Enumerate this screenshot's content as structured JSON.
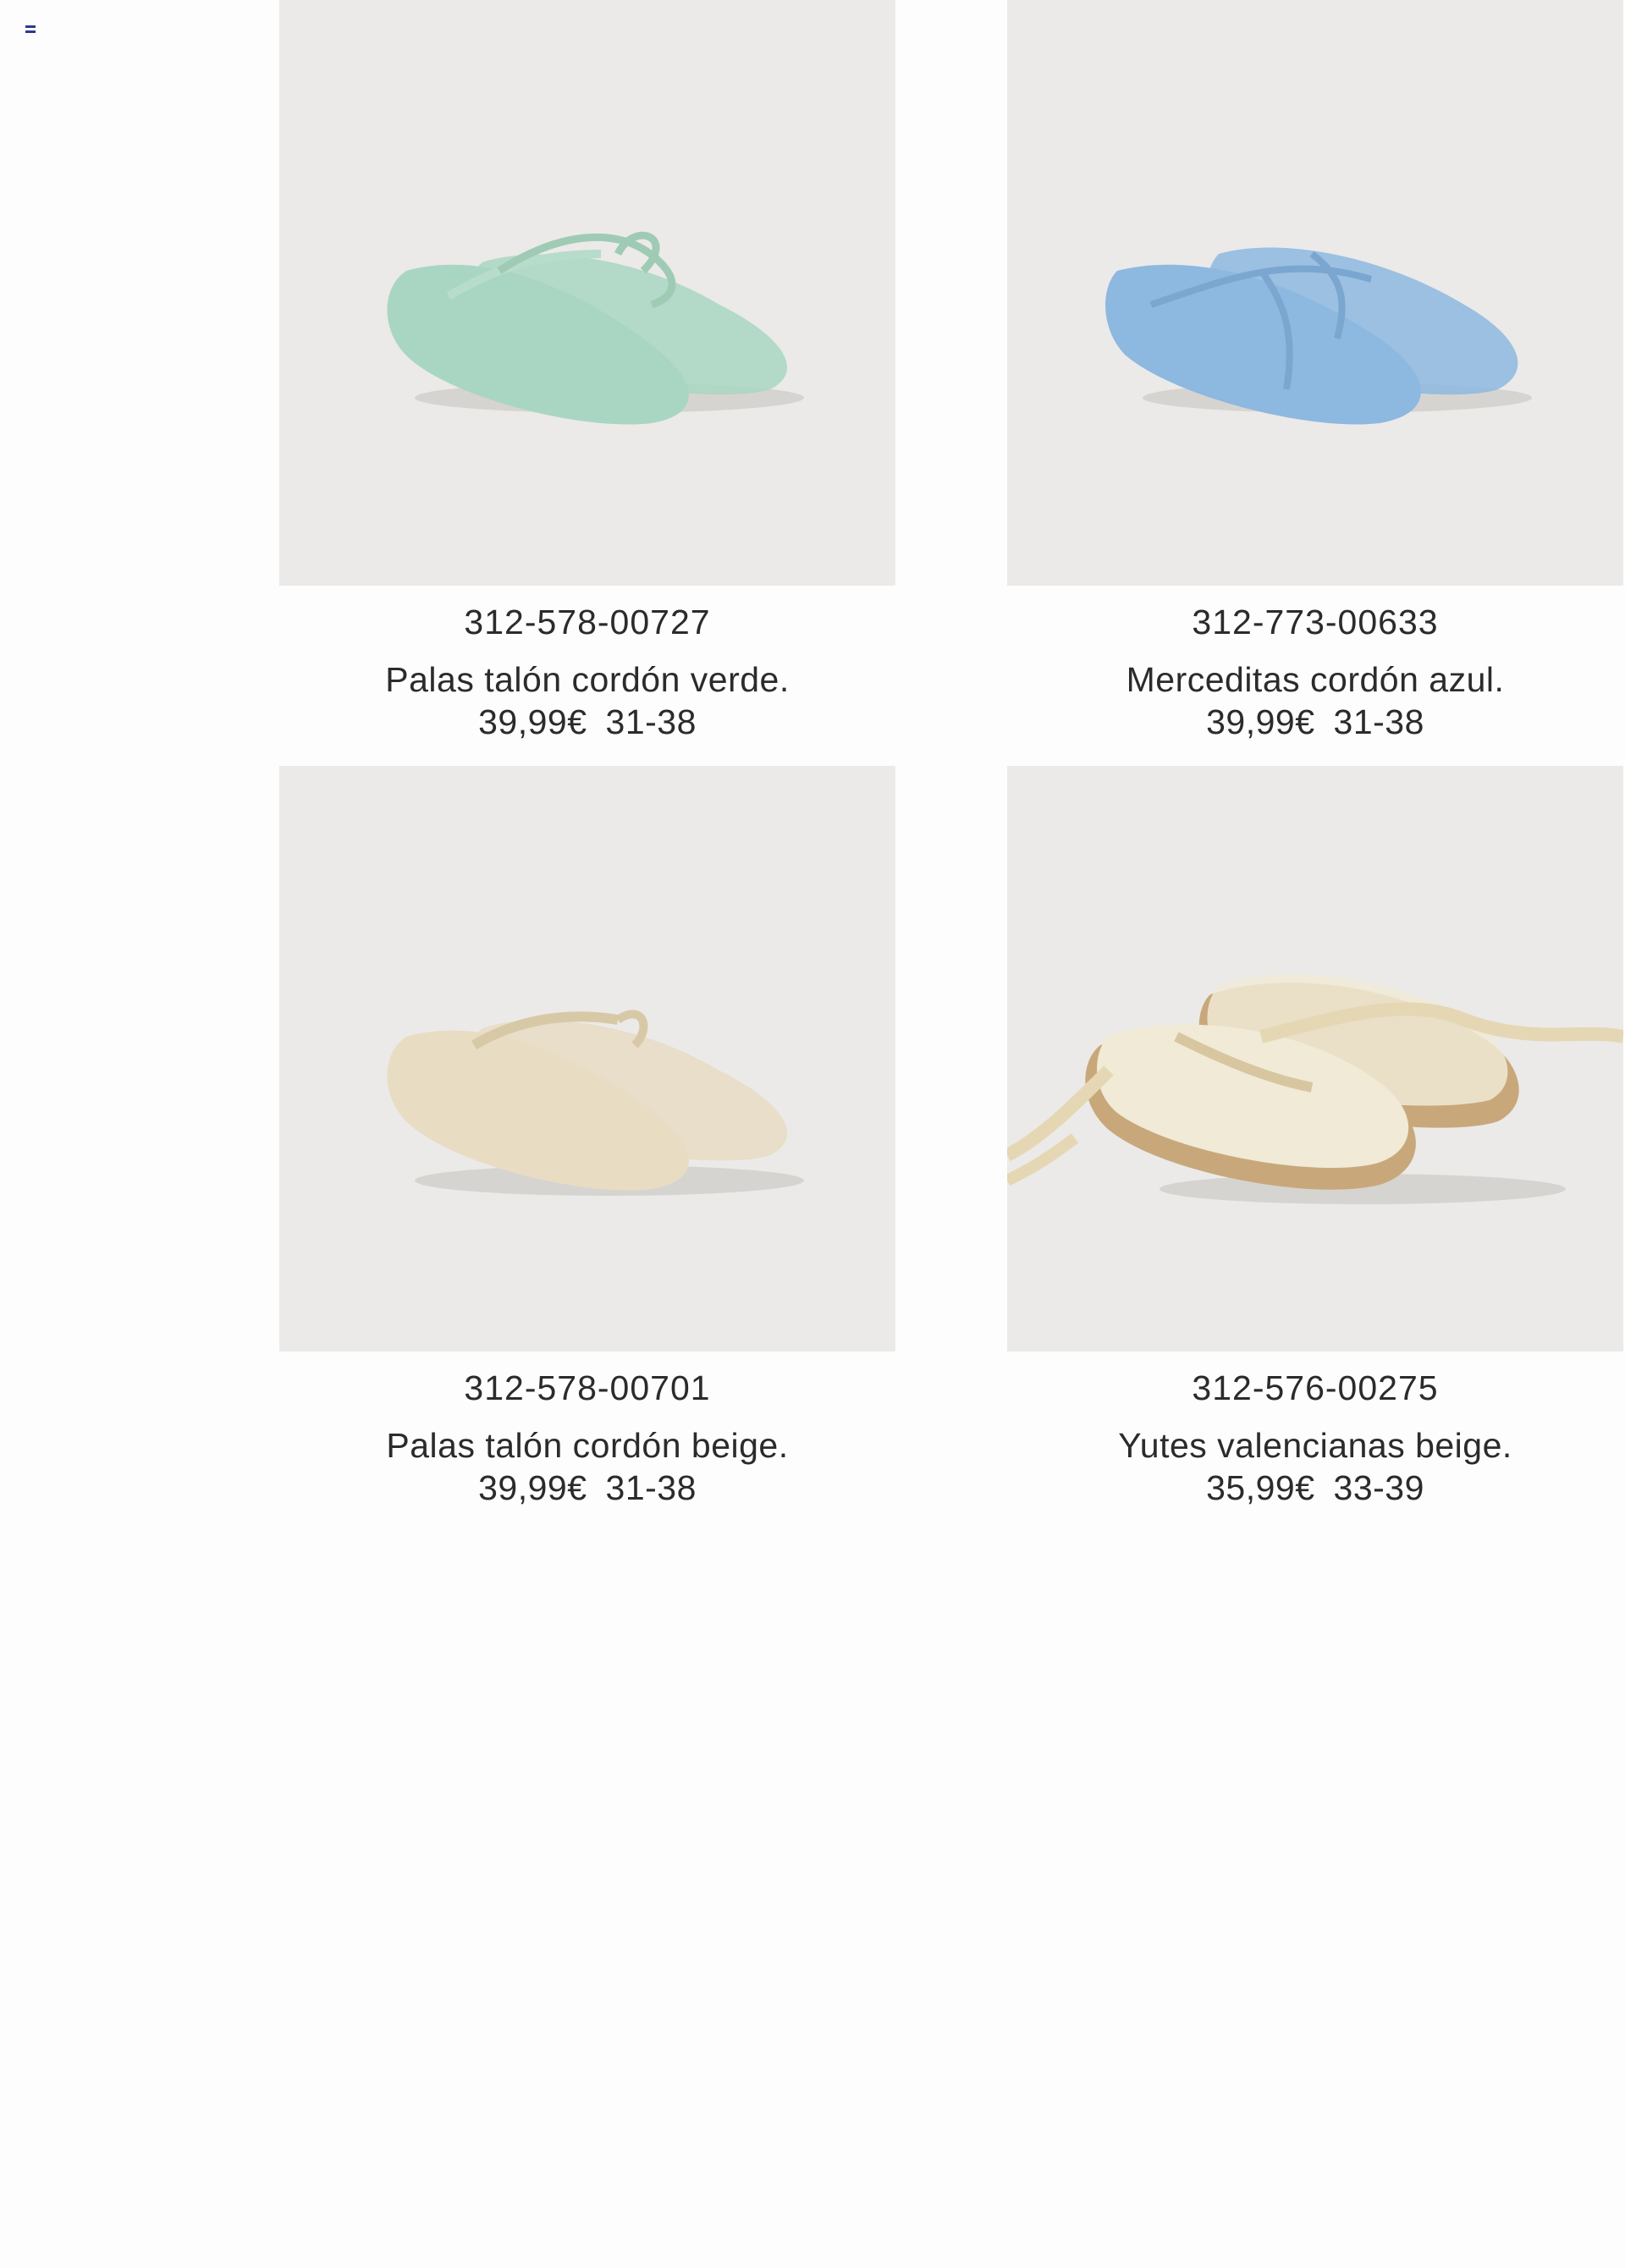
{
  "header": {
    "flag_icon": "flag-icon",
    "flag_colors": [
      "#2c3a8c",
      "#ffffff",
      "#2c3a8c"
    ]
  },
  "products": [
    {
      "ref": "312-578-00727",
      "name": "Palas talón cordón verde.",
      "price": "39,99€",
      "sizes": "31-38",
      "shoe_color": "#a9d6c2"
    },
    {
      "ref": "312-773-00633",
      "name": "Merceditas cordón azul.",
      "price": "39,99€",
      "sizes": "31-38",
      "shoe_color": "#8db8df"
    },
    {
      "ref": "312-578-00701",
      "name": "Palas talón cordón beige.",
      "price": "39,99€",
      "sizes": "31-38",
      "shoe_color": "#e8dcc3"
    },
    {
      "ref": "312-576-00275",
      "name": "Yutes valencianas beige.",
      "price": "35,99€",
      "sizes": "33-39",
      "shoe_color": "#f0ead6"
    }
  ]
}
